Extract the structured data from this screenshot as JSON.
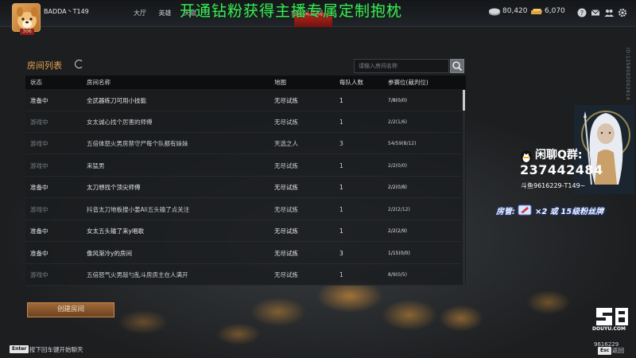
{
  "header": {
    "avatar_level": "306",
    "player_name": "BADDA丶T149",
    "nav_items": [
      "大厅",
      "英雄",
      "天赋",
      "",
      "",
      "",
      "自定义房间"
    ],
    "banner": "开通钻粉获得主播专属定制抱枕",
    "gems": "80,420",
    "gold": "6,070",
    "icons": [
      "help-icon",
      "mail-icon",
      "friends-icon",
      "settings-icon"
    ]
  },
  "vertical_id": "ID:1258002002614",
  "room_list": {
    "title": "房间列表",
    "search_placeholder": "请输入房间名称",
    "columns": [
      "状态",
      "房间名称",
      "地图",
      "每队人数",
      "参赛位(裁判位)"
    ],
    "rows": [
      {
        "status": "准备中",
        "name": "全武器练刀可用小技能",
        "map": "无尽试炼",
        "count": "1",
        "slots": "7/8(0/0)"
      },
      {
        "status": "游戏中",
        "name": "女太诚心找个厉害的师傅",
        "map": "无尽试炼",
        "count": "1",
        "slots": "2/2(1/6)"
      },
      {
        "status": "游戏中",
        "name": "五倍体怒火男房禁守尸每个队都有妹妹",
        "map": "天选之人",
        "count": "3",
        "slots": "54/59(8/12)"
      },
      {
        "status": "游戏中",
        "name": "来猛男",
        "map": "无尽试炼",
        "count": "1",
        "slots": "2/2(0/0)"
      },
      {
        "status": "准备中",
        "name": "太刀想找个顶尖师傅",
        "map": "无尽试炼",
        "count": "1",
        "slots": "2/2(0/8)"
      },
      {
        "status": "游戏中",
        "name": "抖音太刀地板搜小姜Ali五头输了点关注",
        "map": "无尽试炼",
        "count": "1",
        "slots": "2/2(2/12)"
      },
      {
        "status": "准备中",
        "name": "女太五头输了来y唱歌",
        "map": "无尽试炼",
        "count": "1",
        "slots": "2/2(2/9)"
      },
      {
        "status": "准备中",
        "name": "像风渐冷y的房间",
        "map": "无尽试炼",
        "count": "3",
        "slots": "1/15(0/0)"
      },
      {
        "status": "游戏中",
        "name": "五倍怒气火男敲勺乱斗房房主在人满开",
        "map": "无尽试炼",
        "count": "1",
        "slots": "8/9(0/5)"
      }
    ],
    "create_button": "创建房间"
  },
  "footer": {
    "enter_key": "Enter",
    "enter_hint": "按下回车键开始聊天",
    "esc_key": "Esc",
    "esc_hint": "返回"
  },
  "overlay": {
    "chat_label": "闲聊Q群:",
    "chat_number": "237442484",
    "chat_sub": "斗鱼9616229-T149~",
    "fan_note_prefix": "房管:",
    "fan_note_mult": "×2",
    "fan_note_suffix": "或 15级粉丝牌",
    "platform_text": "DOUYU.COM",
    "room_id": "9616229"
  },
  "colors": {
    "accent_orange": "#e8a34e",
    "banner_green": "#3ee85a",
    "create_button": "#8a5a30"
  }
}
